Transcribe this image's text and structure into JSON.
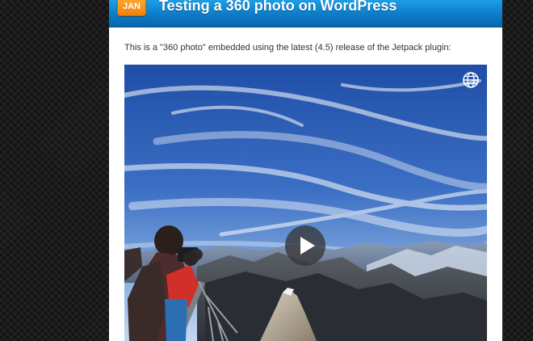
{
  "post": {
    "date_badge": "JAN",
    "title": "Testing a 360 photo on WordPress",
    "intro": "This is a \"360 photo\" embedded using the latest (4.5) release of the Jetpack plugin:"
  },
  "embed": {
    "icons": {
      "panorama": "globe-icon",
      "play": "play-icon"
    }
  },
  "colors": {
    "header_blue": "#0d7cc7",
    "badge_orange": "#f79a1e",
    "sky_blue": "#2d5fb4"
  }
}
